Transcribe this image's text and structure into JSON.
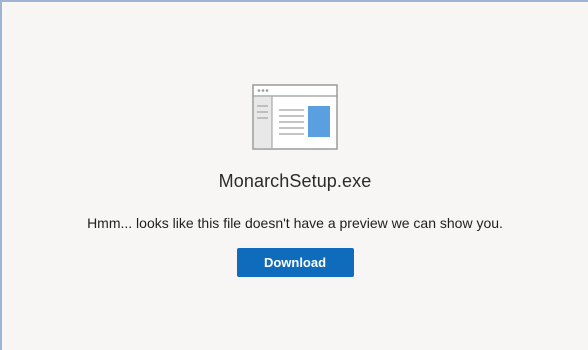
{
  "preview": {
    "icon": "file-preview-icon",
    "file_name": "MonarchSetup.exe",
    "message": "Hmm... looks like this file doesn't have a preview we can show you.",
    "download_label": "Download"
  },
  "colors": {
    "accent": "#0f6cbd",
    "background": "#f7f6f5",
    "frame_border": "#9fb4d3"
  }
}
